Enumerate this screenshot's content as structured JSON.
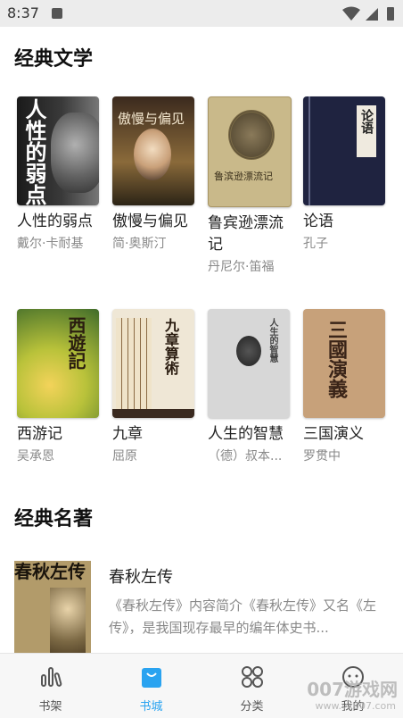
{
  "status_bar": {
    "time": "8:37"
  },
  "sections": [
    {
      "title": "经典文学"
    },
    {
      "title": "经典名著"
    }
  ],
  "books": [
    {
      "title": "人性的弱点",
      "author": "戴尔·卡耐基",
      "cover_text": "人性的弱点"
    },
    {
      "title": "傲慢与偏见",
      "author": "简·奥斯汀",
      "cover_text": "傲慢与偏见"
    },
    {
      "title": "鲁宾逊漂流记",
      "author": "丹尼尔·笛福",
      "cover_text": "鲁滨逊漂流记"
    },
    {
      "title": "论语",
      "author": "孔子",
      "cover_text": "论语"
    },
    {
      "title": "西游记",
      "author": "吴承恩",
      "cover_text": "西遊記"
    },
    {
      "title": "九章",
      "author": "屈原",
      "cover_text": "九章算術"
    },
    {
      "title": "人生的智慧",
      "author": "（德）叔本...",
      "cover_text": "人生的智慧"
    },
    {
      "title": "三国演义",
      "author": "罗贯中",
      "cover_text": "三國演義"
    }
  ],
  "list_item": {
    "title": "春秋左传",
    "cover_text": "春秋左传",
    "description": "《春秋左传》内容简介《春秋左传》又名《左传》，是我国现存最早的编年体史书..."
  },
  "tabs": [
    {
      "label": "书架",
      "icon": "bars-icon"
    },
    {
      "label": "书城",
      "icon": "shopping-bag-icon",
      "active": true
    },
    {
      "label": "分类",
      "icon": "grid-icon"
    },
    {
      "label": "我的",
      "icon": "profile-icon"
    }
  ],
  "watermark": {
    "text": "007游戏网",
    "url": "www.yx007.com"
  },
  "colors": {
    "accent": "#2aa3f0"
  }
}
